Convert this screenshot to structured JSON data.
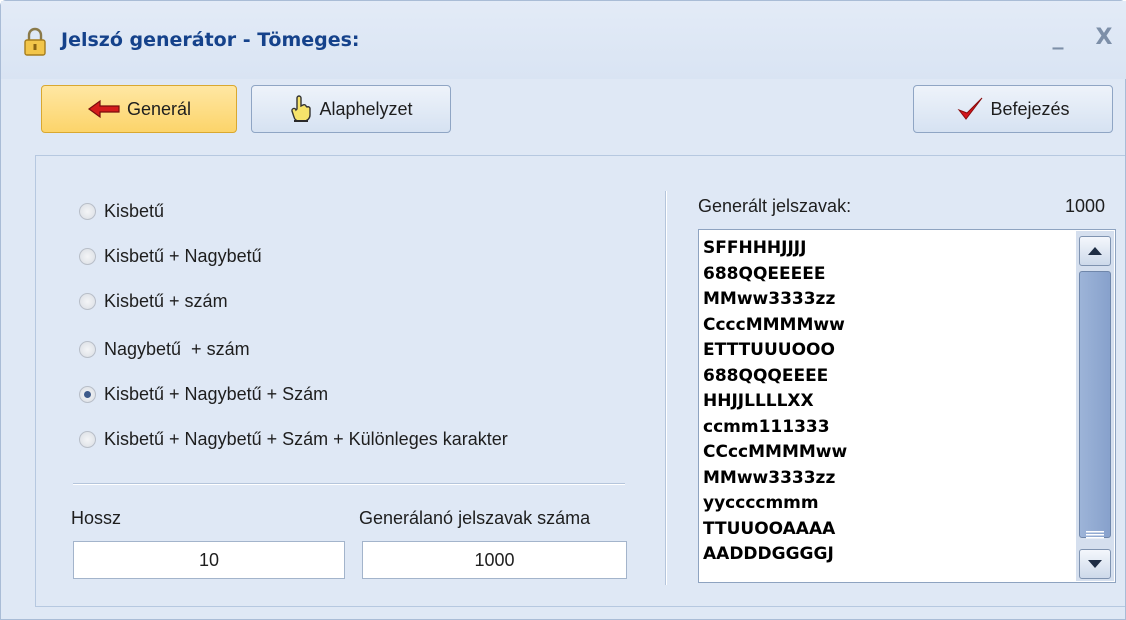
{
  "window": {
    "title": "Jelszó generátor - Tömeges:",
    "minimize": "_",
    "close": "X"
  },
  "toolbar": {
    "generate_label": "Generál",
    "reset_label": "Alaphelyzet",
    "finish_label": "Befejezés"
  },
  "options": [
    {
      "label": "Kisbetű",
      "checked": false
    },
    {
      "label": "Kisbetű + Nagybetű",
      "checked": false
    },
    {
      "label": "Kisbetű + szám",
      "checked": false
    },
    {
      "label": "Nagybetű  + szám",
      "checked": false
    },
    {
      "label": "Kisbetű + Nagybetű + Szám",
      "checked": true
    },
    {
      "label": "Kisbetű + Nagybetű + Szám + Különleges karakter",
      "checked": false
    }
  ],
  "length": {
    "label": "Hossz",
    "value": "10"
  },
  "count": {
    "label": "Generálanó jelszavak száma",
    "value": "1000"
  },
  "results": {
    "label": "Generált jelszavak:",
    "count": "1000",
    "items": [
      "SFFHHHJJJJ",
      "688QQEEEEE",
      "MMww3333zz",
      "CcccMMMMww",
      "ETTTUUUOOO",
      "688QQQEEEE",
      "HHJJLLLLXX",
      "ccmm111333",
      "CCccMMMMww",
      "MMww3333zz",
      "yyccccmmm",
      "TTUUOOAAAA",
      "AADDDGGGGJ"
    ]
  },
  "colors": {
    "title_text": "#15428b",
    "active_button": "#fcd46a",
    "window_bg": "#dfe8f5"
  }
}
